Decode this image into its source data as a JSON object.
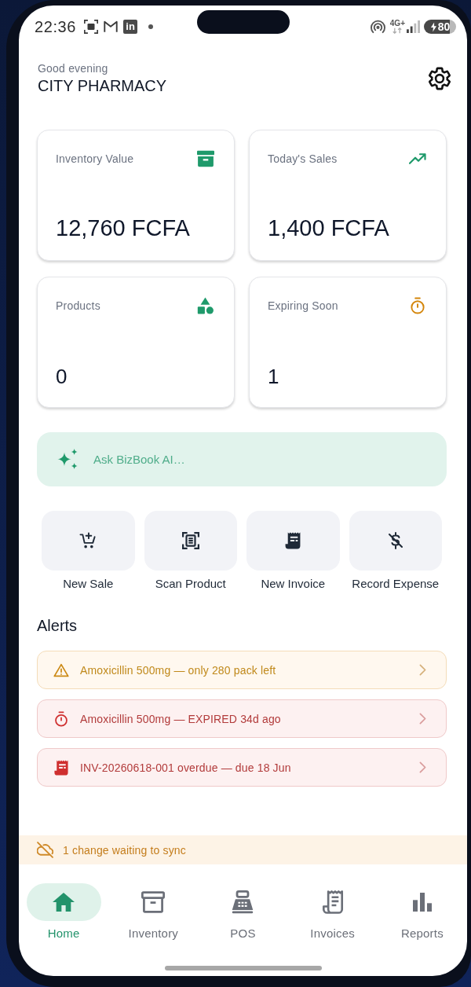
{
  "status_bar": {
    "time": "22:36",
    "app_badge": "in",
    "network": "4G+",
    "battery": "80",
    "charging": true
  },
  "header": {
    "greeting": "Good evening",
    "business_name": "CITY PHARMACY"
  },
  "stats": [
    {
      "kind": "inventory",
      "label": "Inventory Value",
      "value": "12,760 FCFA"
    },
    {
      "kind": "sales",
      "label": "Today's Sales",
      "value": "1,400 FCFA"
    },
    {
      "kind": "products",
      "label": "Products",
      "value": "0"
    },
    {
      "kind": "expiring",
      "label": "Expiring Soon",
      "value": "1"
    }
  ],
  "assistant": {
    "placeholder": "Ask BizBook AI…"
  },
  "quick_actions": [
    {
      "kind": "sale",
      "label": "New Sale"
    },
    {
      "kind": "scan",
      "label": "Scan Product"
    },
    {
      "kind": "invoice",
      "label": "New Invoice"
    },
    {
      "kind": "expense",
      "label": "Record Expense"
    }
  ],
  "alerts": {
    "title": "Alerts",
    "items": [
      {
        "kind": "low_stock",
        "text": "Amoxicillin 500mg — only 280 pack left"
      },
      {
        "kind": "expired",
        "text": "Amoxicillin 500mg — EXPIRED 34d ago"
      },
      {
        "kind": "overdue_invoice",
        "text": "INV-20260618-001 overdue — due 18 Jun"
      }
    ]
  },
  "sync_banner": {
    "text": "1 change waiting to sync"
  },
  "nav": [
    {
      "kind": "home",
      "label": "Home",
      "selected": true
    },
    {
      "kind": "inventory",
      "label": "Inventory",
      "selected": false
    },
    {
      "kind": "pos",
      "label": "POS",
      "selected": false
    },
    {
      "kind": "invoices",
      "label": "Invoices",
      "selected": false
    },
    {
      "kind": "reports",
      "label": "Reports",
      "selected": false
    }
  ]
}
